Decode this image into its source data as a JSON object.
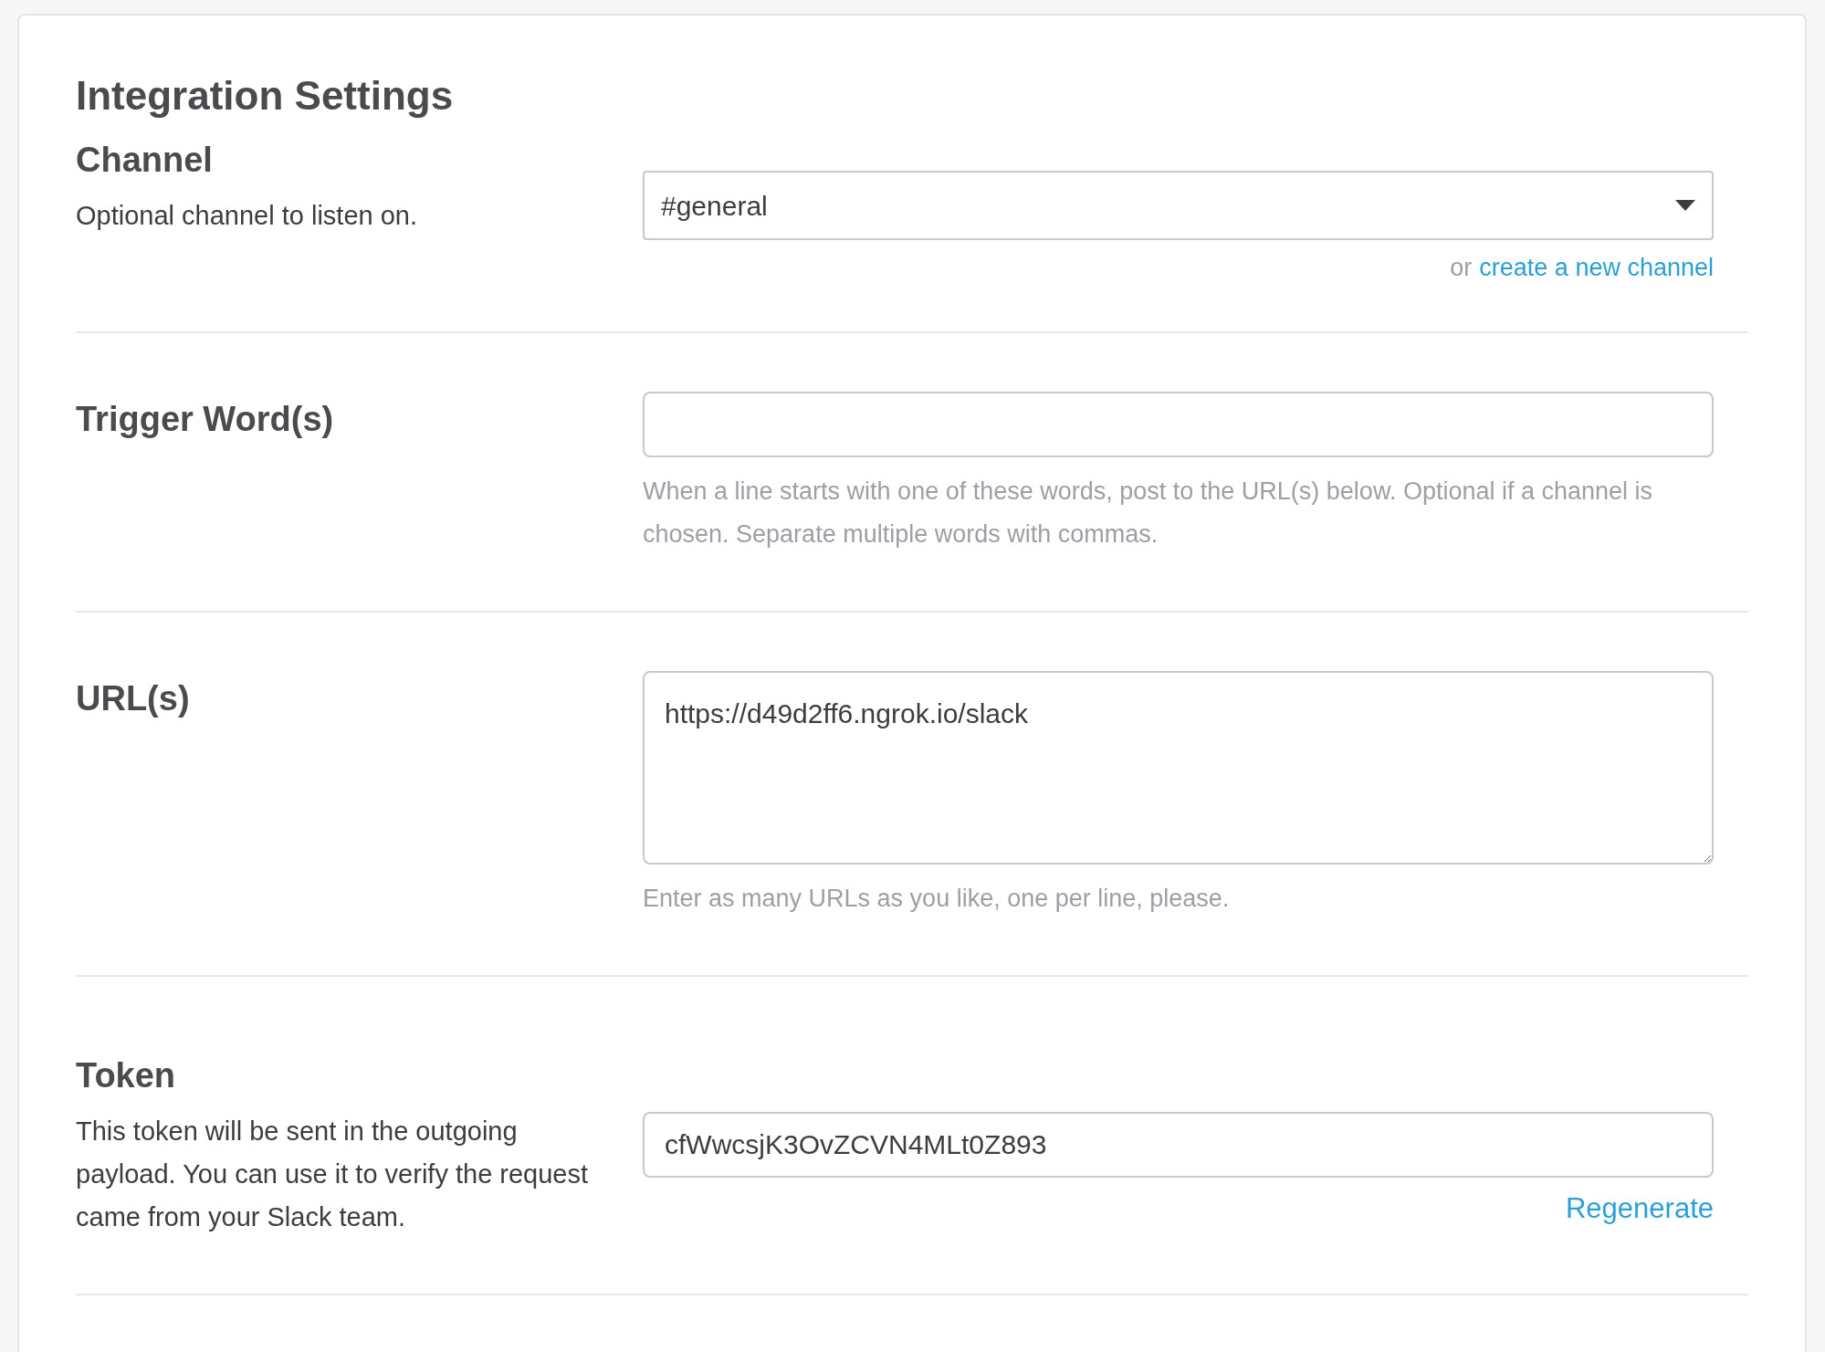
{
  "title": "Integration Settings",
  "sections": [
    {
      "kind": "select",
      "label": "Channel",
      "description": "Optional channel to listen on.",
      "value": "#general",
      "link_prefix": "or",
      "link": "create a new channel"
    },
    {
      "kind": "input",
      "label": "Trigger Word(s)",
      "help": "When a line starts with one of these words, post to the URL(s) below. Optional if a channel is chosen. Separate multiple words with commas."
    },
    {
      "kind": "textarea",
      "label": "URL(s)",
      "value": "https://d49d2ff6.ngrok.io/slack",
      "help": "Enter as many URLs as you like, one per line, please."
    },
    {
      "kind": "input",
      "label": "Token",
      "description": "This token will be sent in the outgoing payload. You can use it to verify the request came from your Slack team.",
      "value": "cfWwcsjK3OvZCVN4MLt0Z893",
      "action": "Regenerate"
    }
  ]
}
